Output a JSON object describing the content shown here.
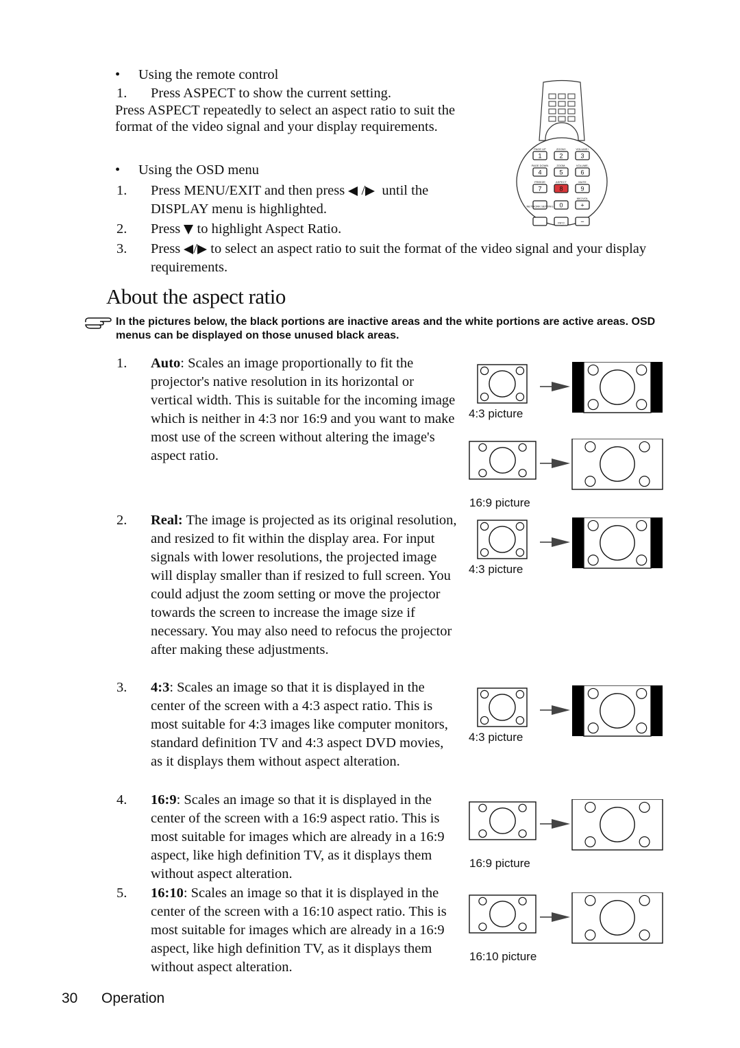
{
  "remote_section": {
    "bullet": "•",
    "title": "Using the remote control",
    "step1_num": "1.",
    "step1_pre": "Press ",
    "step1_key": "ASPECT",
    "step1_post": " to show the current setting.",
    "para_pre": "Press ",
    "para_key": "ASPECT",
    "para_post": " repeatedly to select an aspect ratio to suit the format of the video signal and your display requirements."
  },
  "remote_image": {
    "buttons": [
      {
        "label": "PAGE UP",
        "key": "1"
      },
      {
        "label": "ZOOM+",
        "key": "2"
      },
      {
        "label": "VOLUME+",
        "key": "3"
      },
      {
        "label": "PAGE DOWN",
        "key": "4"
      },
      {
        "label": "ZOOM-",
        "key": "5"
      },
      {
        "label": "VOLUME-",
        "key": "6"
      },
      {
        "label": "FREEZE",
        "key": "7"
      },
      {
        "label": "ASPECT",
        "key": "8"
      },
      {
        "label": "MUTE",
        "key": "9"
      },
      {
        "label": "",
        "key": "NETWORK SETTING"
      },
      {
        "label": "",
        "key": "0"
      },
      {
        "label": "MIC/VOL",
        "key": "+"
      },
      {
        "label": "",
        "key": ""
      },
      {
        "label": "",
        "key": "INFO"
      },
      {
        "label": "",
        "key": "−"
      }
    ],
    "highlight_color": "#d9363a"
  },
  "osd_section": {
    "bullet": "•",
    "title": "Using the OSD menu",
    "steps": [
      {
        "num": "1.",
        "pre": "Press ",
        "key": "MENU/EXIT",
        "mid": " and then press ",
        "sep": "/",
        "post": " until the",
        "line2_key": "DISPLAY",
        "line2_post": " menu is highlighted."
      },
      {
        "num": "2.",
        "pre": "Press ",
        "mid": " to highlight ",
        "key": "Aspect Ratio",
        "post": "."
      },
      {
        "num": "3.",
        "pre": "Press ",
        "sep": "/",
        "post": " to select an aspect ratio to suit the format of the video signal and your display requirements."
      }
    ]
  },
  "section": {
    "title": "About the aspect ratio",
    "note_icon": "pointing-hand-icon",
    "note": "In the pictures below, the black portions are inactive areas and the white portions are active areas. OSD menus can be displayed on those unused black areas."
  },
  "items": [
    {
      "num": "1.",
      "term": "Auto",
      "text": ": Scales an image proportionally to fit the projector's native resolution in its horizontal or vertical width. This is suitable for the incoming image which is neither in 4:3 nor 16:9 and you want to make most use of the screen without altering the image's aspect ratio."
    },
    {
      "num": "2.",
      "term": "Real:",
      "text": " The image is projected as its original resolution, and resized to fit within the display area. For input signals with lower resolutions, the projected image will display smaller than if resized to full screen. You could adjust the zoom setting or move the projector towards the screen to increase the image size if necessary. You may also need to refocus the projector after making these adjustments."
    },
    {
      "num": "3.",
      "term": "4:3",
      "text": ": Scales an image so that it is displayed in the center of the screen with a 4:3 aspect ratio. This is most suitable for 4:3 images like computer monitors, standard definition TV and 4:3 aspect DVD movies, as it displays them without aspect alteration."
    },
    {
      "num": "4.",
      "term": "16:9",
      "text": ": Scales an image so that it is displayed in the center of the screen with a 16:9 aspect ratio. This is most suitable for images which are already in a 16:9 aspect, like high definition TV, as it displays them without aspect alteration."
    },
    {
      "num": "5.",
      "term": "16:10",
      "text": ": Scales an image so that it is displayed in the center of the screen with a 16:10 aspect ratio. This is most suitable for images which are already in a 16:9 aspect, like high definition TV, as it displays them without aspect alteration."
    }
  ],
  "diagrams": [
    {
      "source": "4:3",
      "caption": "4:3 picture",
      "result": "pillarbox"
    },
    {
      "source": "16:9",
      "caption": "16:9 picture",
      "result": "full"
    },
    {
      "source": "4:3",
      "caption": "4:3 picture",
      "result": "pillarbox"
    },
    {
      "source": "4:3",
      "caption": "4:3 picture",
      "result": "pillarbox"
    },
    {
      "source": "16:9",
      "caption": "16:9 picture",
      "result": "full"
    },
    {
      "source": "16:10",
      "caption": "16:10 picture",
      "result": "full"
    }
  ],
  "footer": {
    "page": "30",
    "section": "Operation"
  }
}
